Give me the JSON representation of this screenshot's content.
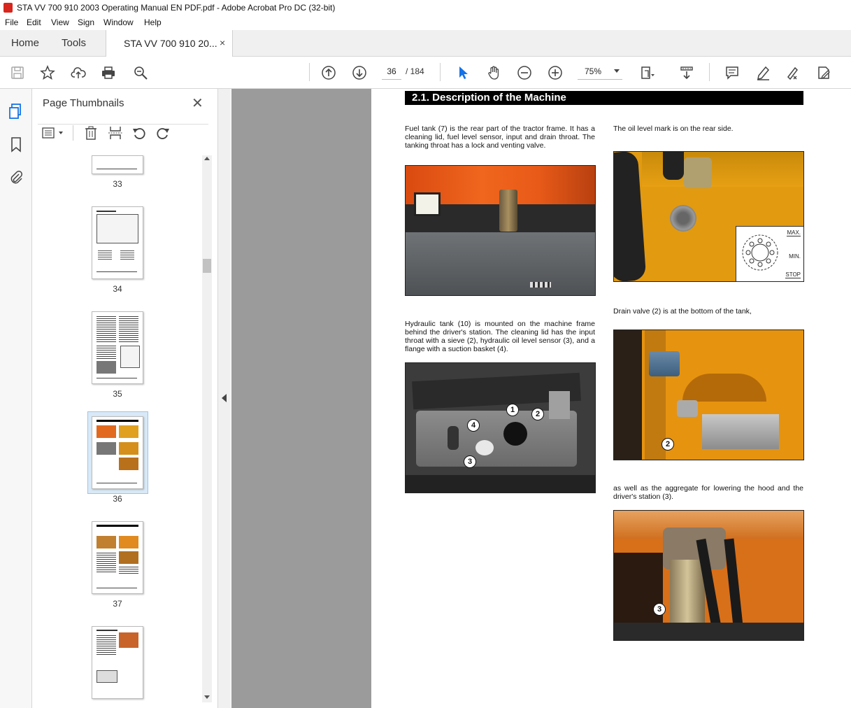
{
  "window": {
    "title": "STA VV 700 910 2003 Operating Manual EN PDF.pdf - Adobe Acrobat Pro DC (32-bit)"
  },
  "menu": [
    "File",
    "Edit",
    "View",
    "Sign",
    "Window",
    "Help"
  ],
  "tabs": {
    "home": "Home",
    "tools": "Tools",
    "document": "STA VV 700 910 20...",
    "close": "×"
  },
  "toolbar": {
    "page_current": "36",
    "page_of": "/ 184",
    "zoom": "75%",
    "colors": {
      "accent": "#1473e6"
    }
  },
  "panel": {
    "title": "Page Thumbnails",
    "close": "✕",
    "thumbnails": [
      {
        "page": "33"
      },
      {
        "page": "34"
      },
      {
        "page": "35"
      },
      {
        "page": "36",
        "selected": true
      },
      {
        "page": "37"
      }
    ]
  },
  "document": {
    "section_title": "2.1.  Description of the Machine",
    "fuel_text": "Fuel tank (7) is the rear part of the tractor frame. It has a cleaning lid, fuel level sensor, input and drain throat. The tanking throat has a lock and venting valve.",
    "oil_mark_text": "The oil level mark is on the rear side.",
    "hydraulic_text": "Hydraulic tank (10) is mounted on the machine frame behind the driver's station. The cleaning lid has the input throat with a sieve (2), hydraulic oil level sensor (3), and a flange with a suction basket (4).",
    "drain_text": "Drain valve (2) is at the bottom of the tank,",
    "aggregate_text": "as well as the aggregate for lowering the hood and the driver's station (3).",
    "gauge_labels": {
      "max": "MAX.",
      "min": "MIN.",
      "stop": "STOP"
    },
    "callouts": {
      "c1": "1",
      "c2": "2",
      "c3": "3",
      "c4": "4",
      "drain": "2",
      "aggregate": "3"
    }
  }
}
